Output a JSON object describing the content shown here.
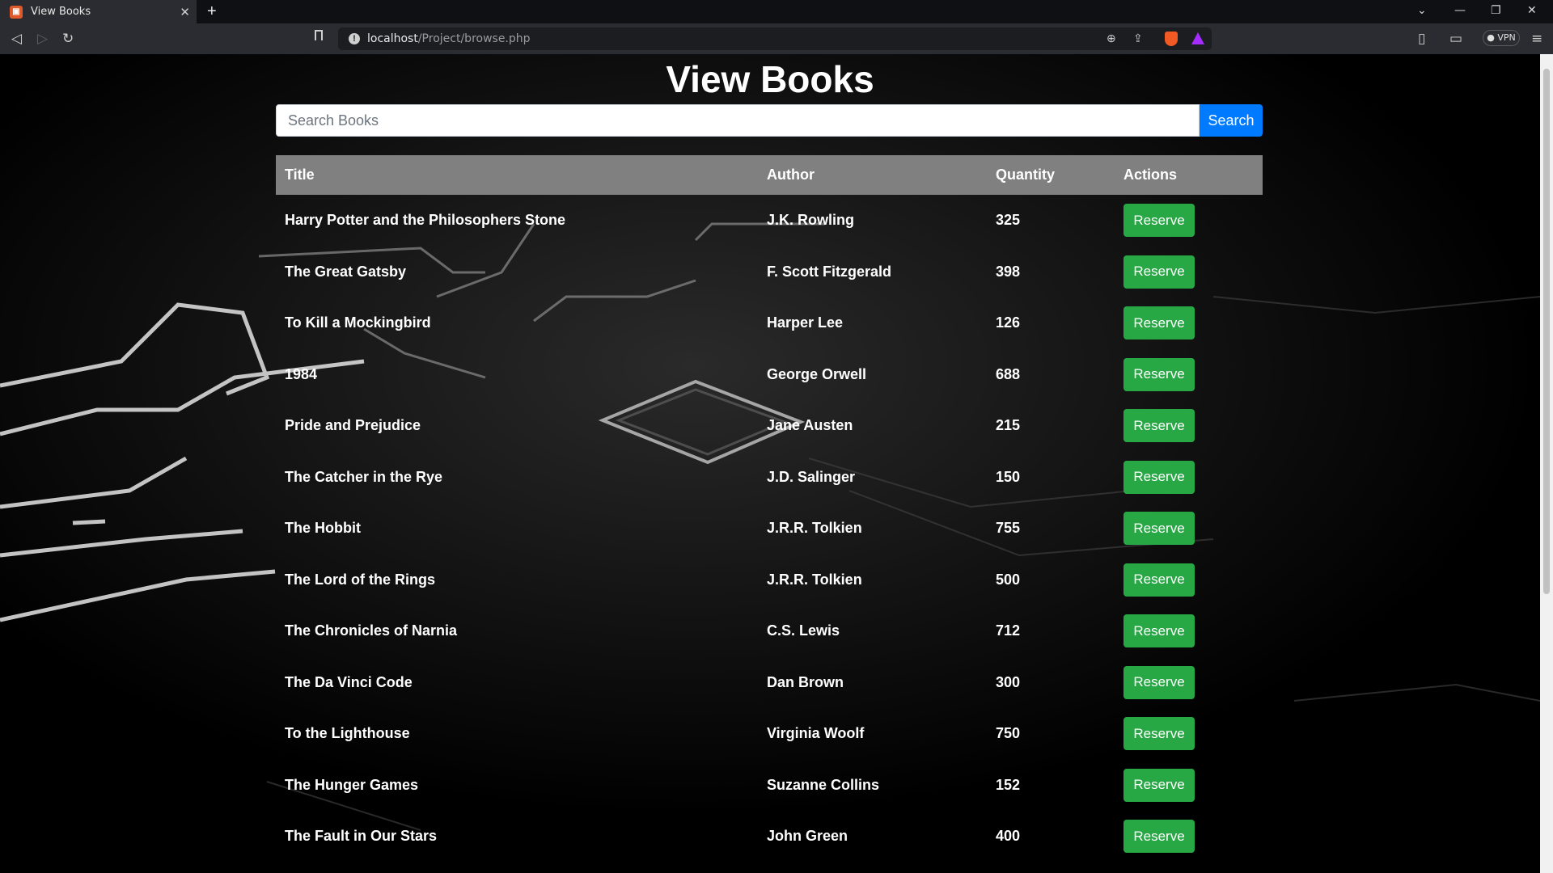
{
  "browser": {
    "tab_title": "View Books",
    "tab_favicon": "brave-page-icon",
    "url_host": "localhost",
    "url_path": "/Project/browse.php",
    "vpn_label": "VPN"
  },
  "page": {
    "title": "View Books",
    "search": {
      "placeholder": "Search Books",
      "value": "",
      "button_label": "Search"
    },
    "table": {
      "headers": [
        "Title",
        "Author",
        "Quantity",
        "Actions"
      ],
      "reserve_label": "Reserve",
      "reserve_color": "#28a745",
      "rows": [
        {
          "title": "Harry Potter and the Philosophers Stone",
          "author": "J.K. Rowling",
          "quantity": "325"
        },
        {
          "title": "The Great Gatsby",
          "author": "F. Scott Fitzgerald",
          "quantity": "398"
        },
        {
          "title": "To Kill a Mockingbird",
          "author": "Harper Lee",
          "quantity": "126"
        },
        {
          "title": "1984",
          "author": "George Orwell",
          "quantity": "688"
        },
        {
          "title": "Pride and Prejudice",
          "author": "Jane Austen",
          "quantity": "215"
        },
        {
          "title": "The Catcher in the Rye",
          "author": "J.D. Salinger",
          "quantity": "150"
        },
        {
          "title": "The Hobbit",
          "author": "J.R.R. Tolkien",
          "quantity": "755"
        },
        {
          "title": "The Lord of the Rings",
          "author": "J.R.R. Tolkien",
          "quantity": "500"
        },
        {
          "title": "The Chronicles of Narnia",
          "author": "C.S. Lewis",
          "quantity": "712"
        },
        {
          "title": "The Da Vinci Code",
          "author": "Dan Brown",
          "quantity": "300"
        },
        {
          "title": "To the Lighthouse",
          "author": "Virginia Woolf",
          "quantity": "750"
        },
        {
          "title": "The Hunger Games",
          "author": "Suzanne Collins",
          "quantity": "152"
        },
        {
          "title": "The Fault in Our Stars",
          "author": "John Green",
          "quantity": "400"
        }
      ]
    }
  },
  "colors": {
    "header_bg": "#808080",
    "search_button": "#007bff",
    "page_bg": "#000000"
  }
}
